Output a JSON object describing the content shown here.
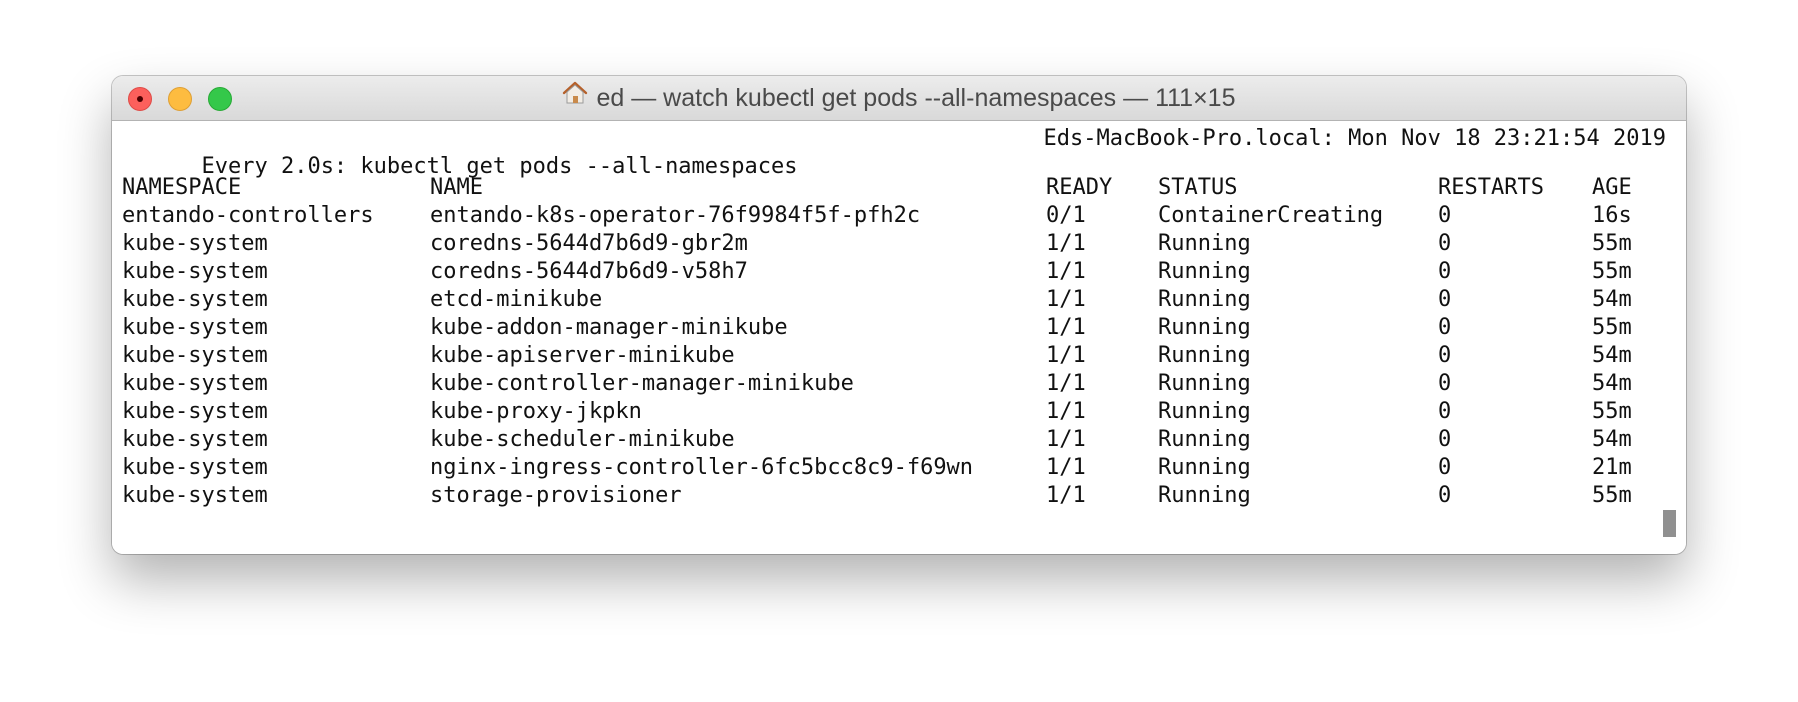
{
  "window": {
    "title": "ed — watch kubectl get pods --all-namespaces — 111×15",
    "title_icon": "home-icon"
  },
  "terminal": {
    "header_left": "Every 2.0s: kubectl get pods --all-namespaces",
    "header_right": "Eds-MacBook-Pro.local: Mon Nov 18 23:21:54 2019",
    "columns": [
      "NAMESPACE",
      "NAME",
      "READY",
      "STATUS",
      "RESTARTS",
      "AGE"
    ],
    "rows": [
      {
        "namespace": "entando-controllers",
        "name": "entando-k8s-operator-76f9984f5f-pfh2c",
        "ready": "0/1",
        "status": "ContainerCreating",
        "restarts": "0",
        "age": "16s"
      },
      {
        "namespace": "kube-system",
        "name": "coredns-5644d7b6d9-gbr2m",
        "ready": "1/1",
        "status": "Running",
        "restarts": "0",
        "age": "55m"
      },
      {
        "namespace": "kube-system",
        "name": "coredns-5644d7b6d9-v58h7",
        "ready": "1/1",
        "status": "Running",
        "restarts": "0",
        "age": "55m"
      },
      {
        "namespace": "kube-system",
        "name": "etcd-minikube",
        "ready": "1/1",
        "status": "Running",
        "restarts": "0",
        "age": "54m"
      },
      {
        "namespace": "kube-system",
        "name": "kube-addon-manager-minikube",
        "ready": "1/1",
        "status": "Running",
        "restarts": "0",
        "age": "55m"
      },
      {
        "namespace": "kube-system",
        "name": "kube-apiserver-minikube",
        "ready": "1/1",
        "status": "Running",
        "restarts": "0",
        "age": "54m"
      },
      {
        "namespace": "kube-system",
        "name": "kube-controller-manager-minikube",
        "ready": "1/1",
        "status": "Running",
        "restarts": "0",
        "age": "54m"
      },
      {
        "namespace": "kube-system",
        "name": "kube-proxy-jkpkn",
        "ready": "1/1",
        "status": "Running",
        "restarts": "0",
        "age": "55m"
      },
      {
        "namespace": "kube-system",
        "name": "kube-scheduler-minikube",
        "ready": "1/1",
        "status": "Running",
        "restarts": "0",
        "age": "54m"
      },
      {
        "namespace": "kube-system",
        "name": "nginx-ingress-controller-6fc5bcc8c9-f69wn",
        "ready": "1/1",
        "status": "Running",
        "restarts": "0",
        "age": "21m"
      },
      {
        "namespace": "kube-system",
        "name": "storage-provisioner",
        "ready": "1/1",
        "status": "Running",
        "restarts": "0",
        "age": "55m"
      }
    ]
  }
}
